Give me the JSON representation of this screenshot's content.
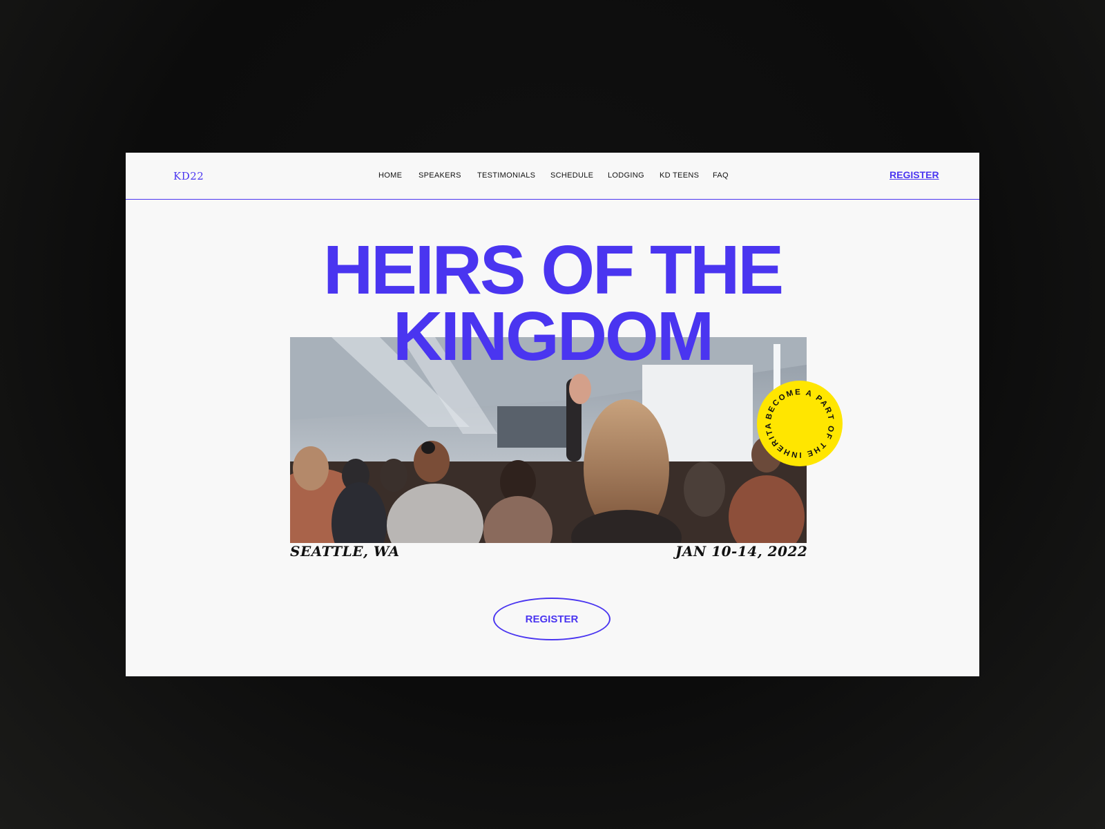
{
  "nav": {
    "logo": "KD22",
    "items": [
      "HOME",
      "SPEAKERS",
      "TESTIMONIALS",
      "SCHEDULE",
      "LODGING",
      "KD TEENS",
      "FAQ"
    ],
    "register_label": "REGISTER"
  },
  "hero": {
    "title_line1": "HEIRS OF THE",
    "title_line2": "KINGDOM",
    "badge_text": "BECOME A PART OF THE INHERITANCE",
    "location": "SEATTLE, WA",
    "dates": "JAN 10-14, 2022",
    "register_label": "REGISTER"
  },
  "colors": {
    "accent": "#4a35f0",
    "badge": "#ffe600",
    "background": "#f8f8f8",
    "backdrop": "#111111"
  }
}
